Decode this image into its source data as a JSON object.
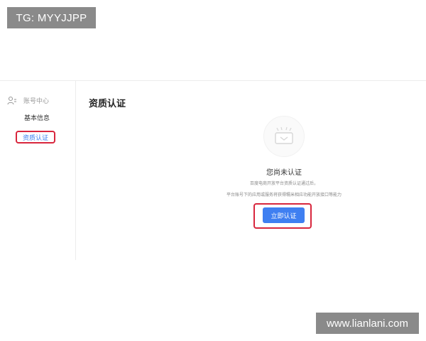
{
  "overlay": {
    "tg_label": "TG: MYYJJPP",
    "watermark": "www.lianlani.com"
  },
  "sidebar": {
    "header_icon": "user-settings-icon",
    "header_label": "账号中心",
    "items": [
      {
        "label": "基本信息",
        "active": false
      },
      {
        "label": "资质认证",
        "active": true
      }
    ]
  },
  "main": {
    "title": "资质认证",
    "empty_state": {
      "icon": "inbox-tray-icon",
      "heading": "您尚未认证",
      "description_line1": "百度电商开放平台资质认证通过后，",
      "description_line2": "平台账号下的应用或服务将获得糯米相应功能开放接口等能力",
      "button_label": "立即认证"
    }
  },
  "colors": {
    "accent": "#3f7ff1",
    "highlight": "#d8263d"
  }
}
